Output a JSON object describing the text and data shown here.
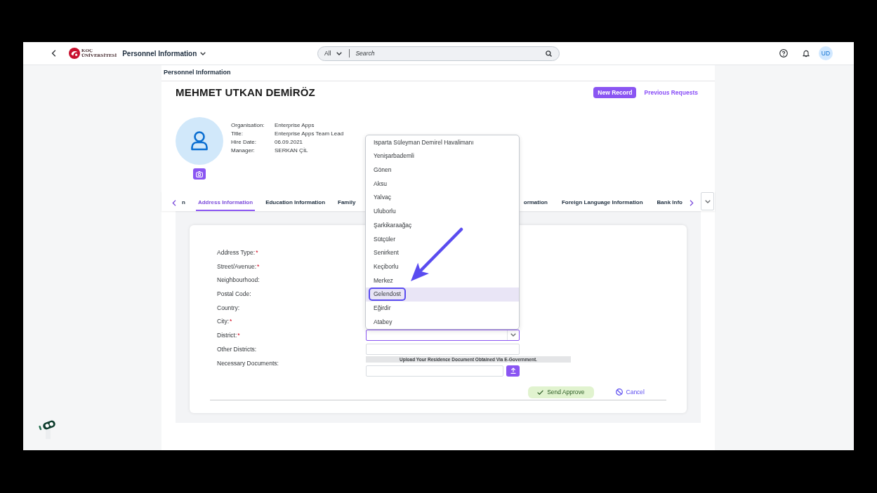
{
  "top_bar": {
    "logo": {
      "line_1": "KOÇ",
      "line_2": "ÜNİVERSİTESİ"
    },
    "app_title": "Personnel Information",
    "search": {
      "scope": "All",
      "placeholder": "Search"
    },
    "user_initials": "UD"
  },
  "breadcrumb": "Personnel Information",
  "employee": {
    "name": "MEHMET UTKAN DEMİRÖZ",
    "details": [
      {
        "label": "Organisation:",
        "value": "Enterprise Apps"
      },
      {
        "label": "Title:",
        "value": "Enterprise Apps Team Lead"
      },
      {
        "label": "Hire Date:",
        "value": "06.09.2021"
      },
      {
        "label": "Manager:",
        "value": "SERKAN ÇİL"
      }
    ]
  },
  "header_actions": [
    {
      "label": "New Record",
      "kind": "primary"
    },
    {
      "label": "Previous Requests",
      "kind": "link"
    }
  ],
  "tabs": [
    {
      "label": "n",
      "selected": false
    },
    {
      "label": "Address Information",
      "selected": true
    },
    {
      "label": "Education Information",
      "selected": false
    },
    {
      "label": "Family",
      "selected": false
    },
    {
      "label": "ormation",
      "selected": false
    },
    {
      "label": "Foreign Language Information",
      "selected": false
    },
    {
      "label": "Bank Info",
      "selected": false
    }
  ],
  "form": {
    "fields": [
      {
        "label": "Address Type:",
        "required_mark": "*",
        "kind": "label"
      },
      {
        "label": "Street/Avenue:",
        "required_mark": "*",
        "kind": "label"
      },
      {
        "label": "Neighbourhood:",
        "kind": "label"
      },
      {
        "label": "Postal Code:",
        "kind": "label"
      },
      {
        "label": "Country:",
        "kind": "label"
      },
      {
        "label": "City:",
        "required_mark": "*",
        "kind": "label"
      },
      {
        "label": "District:",
        "required_mark": "*",
        "kind": "select",
        "focused": true
      },
      {
        "label": "Other Districts:",
        "kind": "text",
        "focused": false
      },
      {
        "label": "Necessary Documents:",
        "kind": "upload",
        "notice": "Upload Your Residence Document Obtained Via E-Government."
      }
    ],
    "actions": [
      {
        "label": "Send Approve",
        "kind": "approve"
      },
      {
        "label": "Cancel",
        "kind": "cancel"
      }
    ]
  },
  "district_dropdown": {
    "options": [
      {
        "label": "Isparta Süleyman Demirel Havalimanı",
        "selected": false,
        "circled": false
      },
      {
        "label": "Yenişarbademli",
        "selected": false,
        "circled": false
      },
      {
        "label": "Gönen",
        "selected": false,
        "circled": false
      },
      {
        "label": "Aksu",
        "selected": false,
        "circled": false
      },
      {
        "label": "Yalvaç",
        "selected": false,
        "circled": false
      },
      {
        "label": "Uluborlu",
        "selected": false,
        "circled": false
      },
      {
        "label": "Şarkikaraağaç",
        "selected": false,
        "circled": false
      },
      {
        "label": "Sütçüler",
        "selected": false,
        "circled": false
      },
      {
        "label": "Senirkent",
        "selected": false,
        "circled": false
      },
      {
        "label": "Keçiborlu",
        "selected": false,
        "circled": false
      },
      {
        "label": "Merkez",
        "selected": false,
        "circled": false
      },
      {
        "label": "Gelendost",
        "selected": true,
        "circled": true
      },
      {
        "label": "Eğirdir",
        "selected": false,
        "circled": false
      },
      {
        "label": "Atabey",
        "selected": false,
        "circled": false
      }
    ]
  }
}
